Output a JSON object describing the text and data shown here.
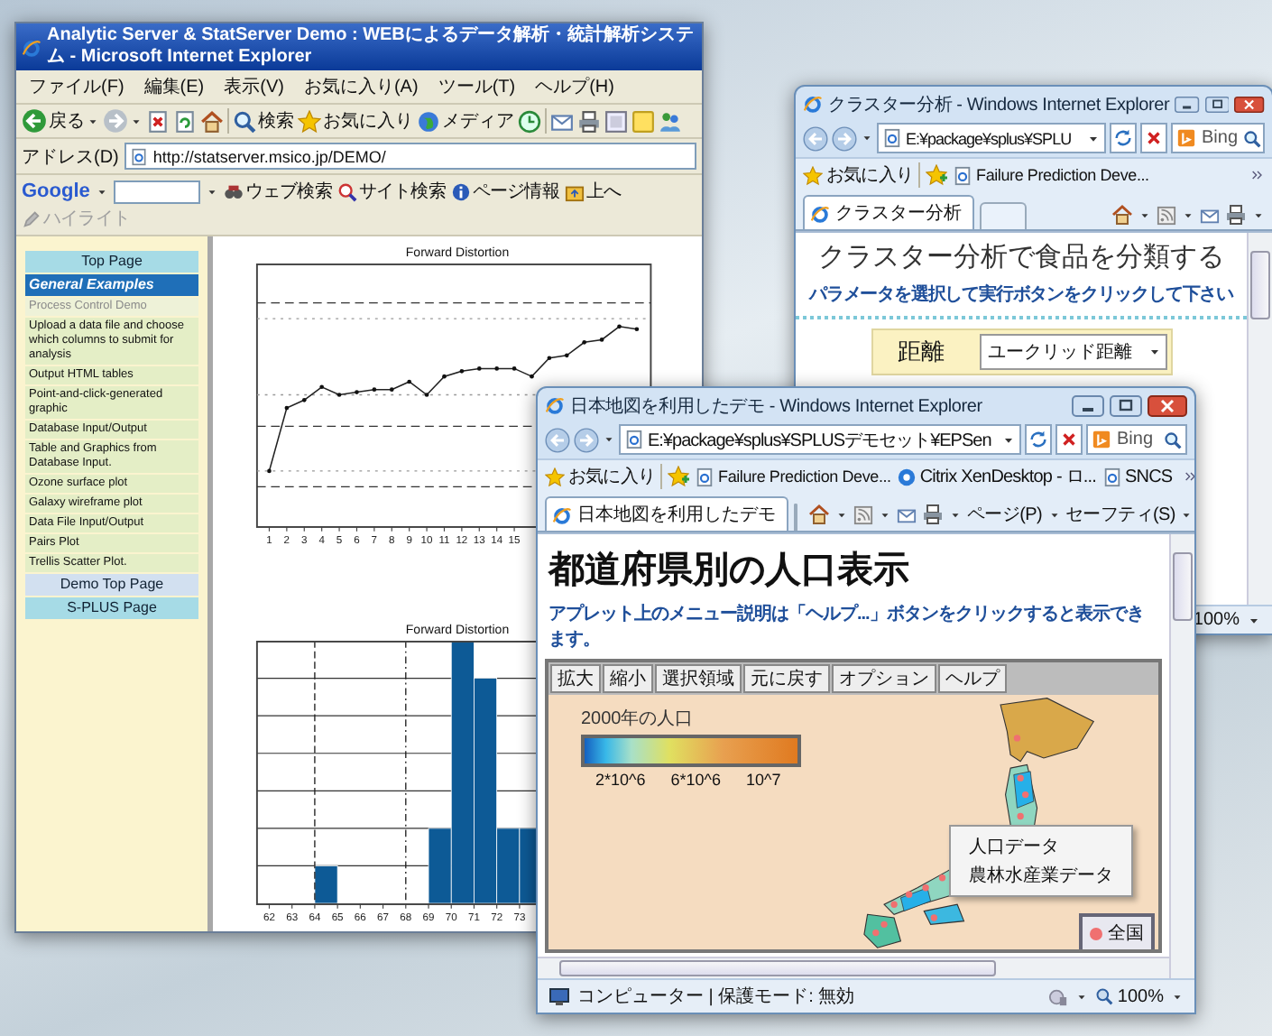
{
  "stat_window": {
    "title": "Analytic Server & StatServer Demo : WEBによるデータ解析・統計解析システム - Microsoft Internet Explorer",
    "menu": [
      "ファイル(F)",
      "編集(E)",
      "表示(V)",
      "お気に入り(A)",
      "ツール(T)",
      "ヘルプ(H)"
    ],
    "toolbar": [
      "戻る",
      "検索",
      "お気に入り",
      "メディア"
    ],
    "address_label": "アドレス(D)",
    "address": "http://statserver.msico.jp/DEMO/",
    "google_bar": {
      "logo": "Google",
      "buttons": [
        {
          "label": "ウェブ検索",
          "disabled": false
        },
        {
          "label": "サイト検索",
          "disabled": false
        },
        {
          "label": "ページ情報",
          "disabled": false
        },
        {
          "label": "上へ",
          "disabled": false
        },
        {
          "label": "ハイライト",
          "disabled": true
        }
      ]
    },
    "sidebar": [
      {
        "label": "Top Page",
        "kind": "button"
      },
      {
        "label": "General Examples",
        "kind": "heading"
      },
      {
        "label": "Process Control Demo",
        "kind": "current"
      },
      {
        "label": "Upload a data file and choose which columns to submit for analysis",
        "kind": "link"
      },
      {
        "label": "Output HTML tables",
        "kind": "link"
      },
      {
        "label": "Point-and-click-generated graphic",
        "kind": "link"
      },
      {
        "label": "Database Input/Output",
        "kind": "link"
      },
      {
        "label": "Table and Graphics from Database Input.",
        "kind": "link"
      },
      {
        "label": "Ozone surface plot",
        "kind": "link"
      },
      {
        "label": "Galaxy wireframe plot",
        "kind": "link"
      },
      {
        "label": "Data File Input/Output",
        "kind": "link"
      },
      {
        "label": "Pairs Plot",
        "kind": "link"
      },
      {
        "label": "Trellis Scatter Plot.",
        "kind": "link"
      },
      {
        "label": "Demo Top Page",
        "kind": "alt-button"
      },
      {
        "label": "S-PLUS Page",
        "kind": "button"
      }
    ],
    "line_chart": {
      "title": "Forward Distortion",
      "xticks": [
        "1",
        "2",
        "3",
        "4",
        "5",
        "6",
        "7",
        "8",
        "9",
        "10",
        "11",
        "12",
        "13",
        "14",
        "15"
      ]
    },
    "histogram": {
      "title": "Forward Distortion",
      "xticks": [
        "62",
        "63",
        "64",
        "65",
        "66",
        "67",
        "68",
        "69",
        "70",
        "71",
        "72",
        "73"
      ]
    }
  },
  "cluster_window": {
    "title": "クラスター分析 - Windows Internet Explorer",
    "address": "E:¥package¥splus¥SPLU",
    "search_provider": "Bing",
    "favorites": [
      {
        "label": "お気に入り",
        "kind": "star"
      },
      {
        "label": "Failure Prediction Deve...",
        "kind": "page"
      }
    ],
    "tab": "クラスター分析",
    "heading": "クラスター分析で食品を分類する",
    "instruction": "パラメータを選択して実行ボタンをクリックして下さい",
    "parameter": {
      "label": "距離",
      "value": "ユークリッド距離"
    },
    "zoom": "100%"
  },
  "map_window": {
    "title": "日本地図を利用したデモ - Windows Internet Explorer",
    "address": "E:¥package¥splus¥SPLUSデモセット¥EPSen",
    "search_provider": "Bing",
    "favorites": [
      {
        "label": "お気に入り",
        "kind": "star"
      },
      {
        "label": "Failure Prediction Deve...",
        "kind": "page"
      },
      {
        "label": "Citrix XenDesktop - ロ...",
        "kind": "citrix"
      },
      {
        "label": "SNCS",
        "kind": "page"
      }
    ],
    "tab": "日本地図を利用したデモ",
    "page_menus": [
      "ページ(P)",
      "セーフティ(S)"
    ],
    "heading": "都道府県別の人口表示",
    "instruction": "アプレット上のメニュー説明は「ヘルプ...」ボタンをクリックすると表示できます。",
    "applet": {
      "buttons": [
        "拡大",
        "縮小",
        "選択領域",
        "元に戻す",
        "オプション",
        "ヘルプ"
      ],
      "legend_title": "2000年の人口",
      "scale_labels": [
        "2*10^6",
        "6*10^6",
        "10^7"
      ],
      "context_menu": [
        "人口データ",
        "農林水産業データ"
      ],
      "region_legend": "全国"
    },
    "status": "コンピューター | 保護モード: 無効",
    "zoom": "100%"
  }
}
